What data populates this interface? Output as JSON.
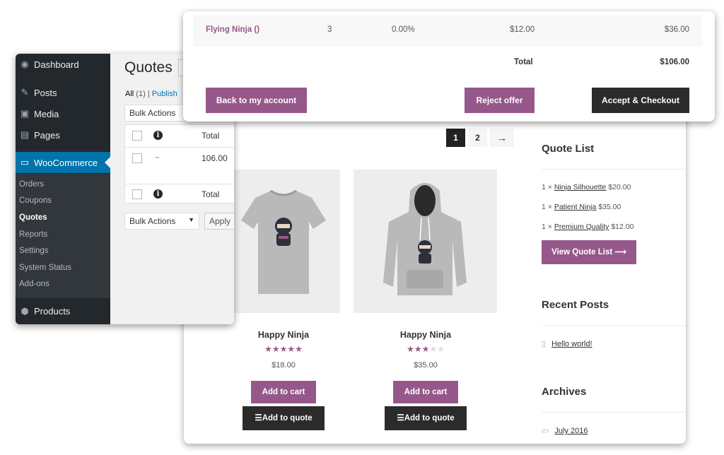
{
  "quote_panel": {
    "row": {
      "product": "Flying Ninja ()",
      "qty": "3",
      "discount": "0.00%",
      "price": "$12.00",
      "subtotal": "$36.00"
    },
    "total_label": "Total",
    "total_value": "$106.00",
    "back_button": "Back to my account",
    "reject_button": "Reject offer",
    "accept_button": "Accept & Checkout"
  },
  "admin_panel": {
    "menu": {
      "dashboard": "Dashboard",
      "posts": "Posts",
      "media": "Media",
      "pages": "Pages",
      "woocommerce": "WooCommerce",
      "products": "Products"
    },
    "submenu": [
      "Orders",
      "Coupons",
      "Quotes",
      "Reports",
      "Settings",
      "System Status",
      "Add-ons"
    ],
    "page_title": "Quotes",
    "views": {
      "all": "All",
      "all_count": "(1)",
      "separator": "|",
      "published": "Publish"
    },
    "bulk_actions": "Bulk Actions",
    "apply": "Apply",
    "table": {
      "header_total": "Total",
      "row_dash": "–",
      "row_total": "106.00",
      "footer_total": "Total",
      "info_glyph": "i"
    }
  },
  "store_panel": {
    "pagination": [
      "1",
      "2",
      "→"
    ],
    "products": [
      {
        "name": "Happy Ninja",
        "rating": 5,
        "price": "$18.00",
        "cart_label": "Add to cart",
        "quote_label": "Add to quote",
        "image": "t-shirt"
      },
      {
        "name": "Happy Ninja",
        "rating": 3,
        "price": "$35.00",
        "cart_label": "Add to cart",
        "quote_label": "Add to quote",
        "image": "hoodie"
      }
    ],
    "sidebar": {
      "quote_list_title": "Quote List",
      "quote_items": [
        {
          "qty": "1 ×",
          "name": "Ninja Silhouette",
          "price": "$20.00"
        },
        {
          "qty": "1 ×",
          "name": "Patient Ninja",
          "price": "$35.00"
        },
        {
          "qty": "1 ×",
          "name": "Premium Quality",
          "price": "$12.00"
        }
      ],
      "view_quote_list": "View Quote List",
      "recent_posts_title": "Recent Posts",
      "recent_post": "Hello world!",
      "archives_title": "Archives",
      "archive": "July 2016"
    }
  },
  "colors": {
    "brand_purple": "#96588a",
    "dark_button": "#2b2b2b",
    "wp_sidebar": "#23282d",
    "wp_active": "#0073aa"
  }
}
